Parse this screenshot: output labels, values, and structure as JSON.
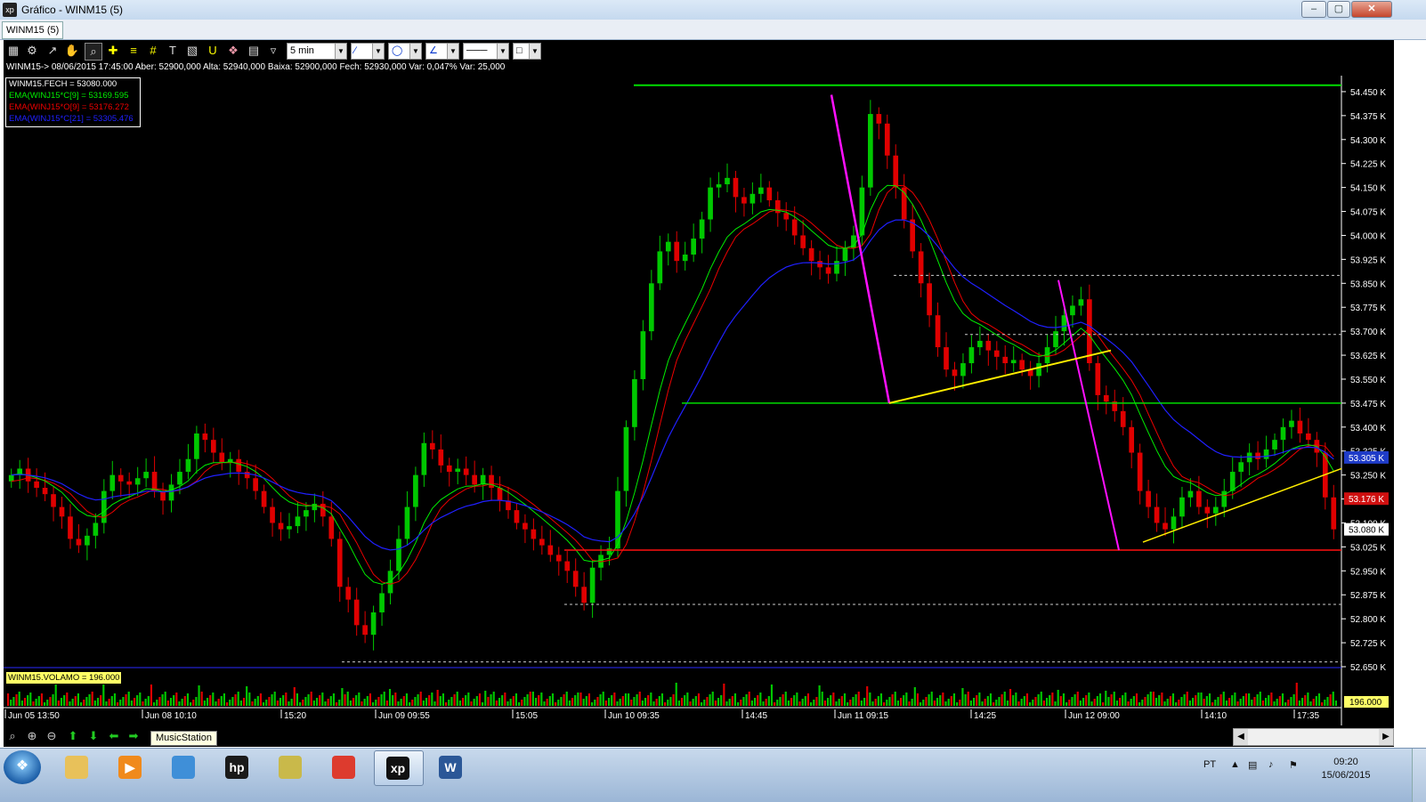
{
  "window": {
    "title": "Gráfico - WINM15 (5)",
    "app_icon": "xp",
    "tab_label": "WINM15 (5)"
  },
  "toolbar": {
    "interval_label": "5 min",
    "icons": [
      "chart-icon",
      "gear-icon",
      "indicator-icon",
      "hand-icon",
      "zoom-icon",
      "crosshair-icon",
      "line-icon",
      "grid-icon",
      "text-icon",
      "calculator-icon",
      "magnet-icon",
      "tag-icon",
      "clipboard-icon",
      "filter-icon"
    ]
  },
  "info_line": "WINM15-> 08/06/2015 17:45:00 Aber: 52900,000 Alta: 52940,000 Baixa: 52900,000 Fech: 52930,000 Var: 0,047% Var: 25,000",
  "legend": [
    {
      "text": "WINM15.FECH = 53080.000",
      "color": "#ffffff"
    },
    {
      "text": "EMA(WINJ15*C[9] = 53169.595",
      "color": "#00ee00"
    },
    {
      "text": "EMA(WINJ15*O[9] = 53176.272",
      "color": "#ee0000"
    },
    {
      "text": "EMA(WINJ15*C[21] = 53305.476",
      "color": "#2020ff"
    }
  ],
  "volume_label": "WINM15.VOLAMO = 196.000",
  "volume_value_badge": "196.000",
  "y_axis_ticks": [
    "54.450 K",
    "54.375 K",
    "54.300 K",
    "54.225 K",
    "54.150 K",
    "54.075 K",
    "54.000 K",
    "53.925 K",
    "53.850 K",
    "53.775 K",
    "53.700 K",
    "53.625 K",
    "53.550 K",
    "53.475 K",
    "53.400 K",
    "53.325 K",
    "53.250 K",
    "53.175 K",
    "53.100 K",
    "53.025 K",
    "52.950 K",
    "52.875 K",
    "52.800 K",
    "52.725 K",
    "52.650 K"
  ],
  "price_badges": [
    {
      "text": "53.305 K",
      "bg": "#1f3cc8",
      "fg": "#ffffff",
      "value": 53305
    },
    {
      "text": "53.176 K",
      "bg": "#d01010",
      "fg": "#ffffff",
      "value": 53176
    },
    {
      "text": "53.080 K",
      "bg": "#ffffff",
      "fg": "#000000",
      "value": 53080
    }
  ],
  "x_axis_labels": [
    "Jun 05 13:50",
    "Jun 08 10:10",
    "15:20",
    "Jun 09 09:55",
    "15:05",
    "Jun 10 09:35",
    "14:45",
    "Jun 11 09:15",
    "14:25",
    "Jun 12 09:00",
    "14:10",
    "17:35"
  ],
  "tooltip": "MusicStation",
  "taskbar": {
    "language": "PT",
    "time": "09:20",
    "date": "15/06/2015",
    "apps": [
      {
        "name": "explorer-icon",
        "label": "",
        "color": "#e8c15a",
        "active": false
      },
      {
        "name": "media-player-icon",
        "label": "▶",
        "color": "#f08a1c",
        "active": false
      },
      {
        "name": "network-icon",
        "label": "",
        "color": "#3f8fd8",
        "active": false
      },
      {
        "name": "hp-icon",
        "label": "hp",
        "color": "#1a1a1a",
        "active": false
      },
      {
        "name": "printer-icon",
        "label": "",
        "color": "#c9b94a",
        "active": false
      },
      {
        "name": "chrome-icon",
        "label": "",
        "color": "#dd3b2e",
        "active": false
      },
      {
        "name": "xp-app-icon",
        "label": "xp",
        "color": "#111111",
        "active": true
      },
      {
        "name": "word-icon",
        "label": "W",
        "color": "#2b5797",
        "active": false
      }
    ]
  },
  "colors": {
    "chart_bg": "#000000",
    "up_candle": "#00c800",
    "down_candle": "#e00000",
    "ema9_close": "#00ee00",
    "ema9_open": "#ee0000",
    "ema21": "#2020ff",
    "support_line": "#00dd00",
    "resistance_line": "#ff1010",
    "trend_line_yellow": "#ffee00",
    "trend_line_magenta": "#ff10ff"
  },
  "chart_data": {
    "type": "candlestick",
    "ylim": [
      52650,
      54500
    ],
    "closes": [
      53250,
      53270,
      53230,
      53210,
      53190,
      53150,
      53120,
      53050,
      53030,
      53060,
      53100,
      53200,
      53250,
      53230,
      53220,
      53240,
      53260,
      53200,
      53170,
      53220,
      53260,
      53300,
      53380,
      53360,
      53320,
      53290,
      53300,
      53260,
      53240,
      53200,
      53150,
      53100,
      53080,
      53090,
      53120,
      53140,
      53160,
      53120,
      53050,
      52900,
      52860,
      52780,
      52750,
      52820,
      52880,
      52950,
      53050,
      53150,
      53250,
      53350,
      53330,
      53280,
      53260,
      53270,
      53250,
      53220,
      53250,
      53210,
      53170,
      53140,
      53100,
      53080,
      53050,
      53030,
      53000,
      52980,
      52950,
      52900,
      52850,
      52960,
      53000,
      53020,
      53200,
      53400,
      53550,
      53700,
      53850,
      53950,
      53980,
      53920,
      53940,
      53990,
      54050,
      54150,
      54160,
      54180,
      54120,
      54100,
      54130,
      54150,
      54110,
      54070,
      54050,
      54000,
      53960,
      53920,
      53900,
      53880,
      53920,
      53960,
      54000,
      54150,
      54380,
      54350,
      54250,
      54150,
      54050,
      53950,
      53850,
      53750,
      53650,
      53580,
      53560,
      53600,
      53650,
      53670,
      53640,
      53620,
      53600,
      53610,
      53580,
      53560,
      53600,
      53650,
      53700,
      53750,
      53780,
      53800,
      53600,
      53500,
      53480,
      53450,
      53400,
      53320,
      53200,
      53150,
      53100,
      53080,
      53120,
      53180,
      53200,
      53150,
      53130,
      53150,
      53200,
      53260,
      53290,
      53320,
      53300,
      53330,
      53360,
      53400,
      53420,
      53380,
      53360,
      53320,
      53180,
      53080
    ]
  }
}
